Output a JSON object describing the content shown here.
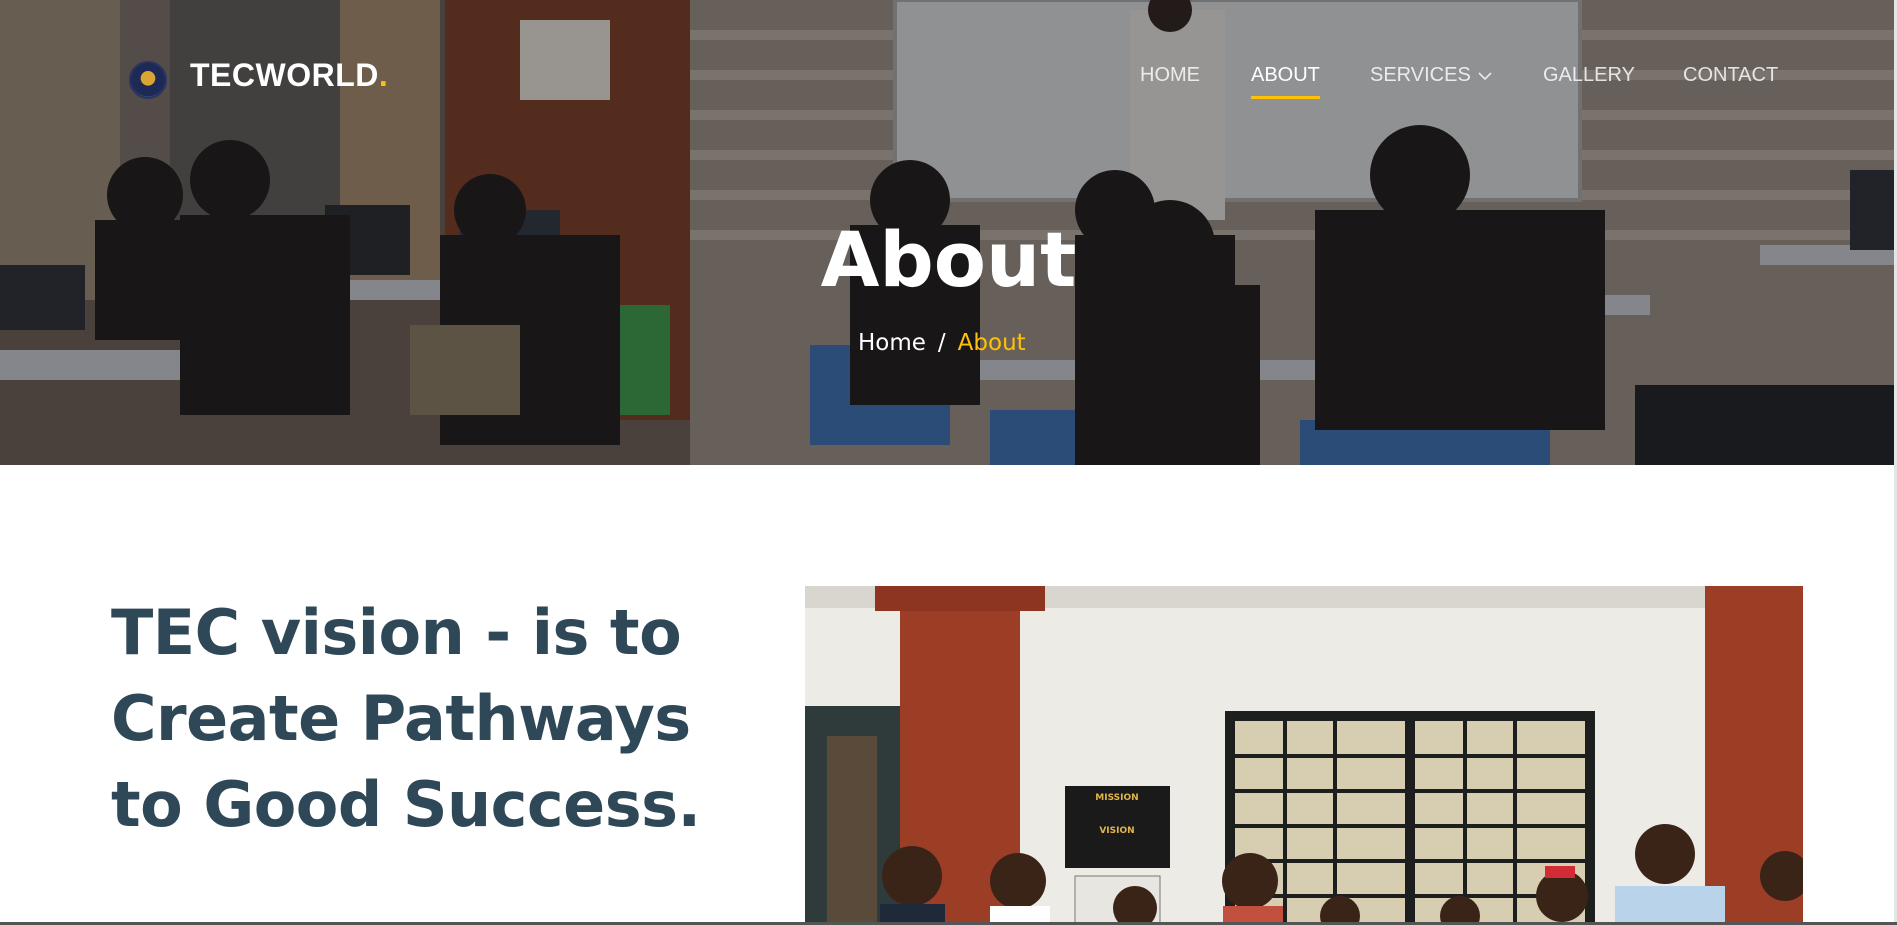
{
  "brand": {
    "name": "TECWORLD",
    "dot": "."
  },
  "nav": {
    "items": [
      {
        "label": "HOME"
      },
      {
        "label": "ABOUT",
        "active": true
      },
      {
        "label": "SERVICES",
        "dropdown": true
      },
      {
        "label": "GALLERY"
      },
      {
        "label": "CONTACT"
      }
    ]
  },
  "hero": {
    "title": "About"
  },
  "breadcrumb": {
    "home": "Home",
    "separator": "/",
    "current": "About"
  },
  "vision": {
    "line1": "TEC vision - is to",
    "line2": "Create Pathways",
    "line3": "to Good Success."
  },
  "photo": {
    "sign_mission": "MISSION",
    "sign_vision": "VISION"
  },
  "colors": {
    "accent": "#ffc107",
    "heading": "#2f4858",
    "white": "#ffffff"
  },
  "icons": {
    "logo": "tecworld-emblem-icon",
    "dropdown": "chevron-down-icon"
  }
}
